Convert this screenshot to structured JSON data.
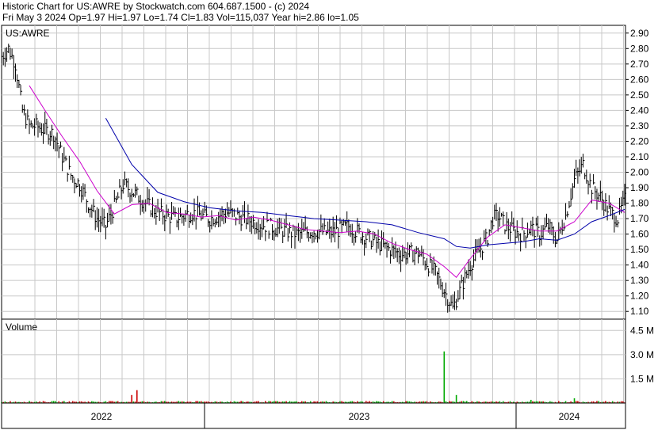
{
  "header": {
    "line1": "Historic Chart for US:AWRE by Stockwatch.com 604.687.1500 - (c) 2024",
    "line2": "Fri May  3 2024  Op=1.97  Hi=1.97  Lo=1.74  Cl=1.83  Vol=115,037  Year hi=2.86  lo=1.05"
  },
  "colors": {
    "price": "#000000",
    "ma_short": "#cc00cc",
    "ma_long": "#0000aa",
    "volume_up": "#00aa00",
    "volume_down": "#cc0000",
    "grid": "#c8c8c8"
  },
  "chart_data": [
    {
      "type": "line",
      "label": "US:AWRE",
      "ylim": [
        1.05,
        2.95
      ],
      "y_ticks": [
        "2.90",
        "2.80",
        "2.70",
        "2.60",
        "2.50",
        "2.40",
        "2.30",
        "2.20",
        "2.10",
        "2.00",
        "1.90",
        "1.80",
        "1.70",
        "1.60",
        "1.50",
        "1.40",
        "1.30",
        "1.20",
        "1.10"
      ],
      "x_labels": [
        "2022",
        "2023",
        "2024"
      ],
      "grid": true,
      "series": [
        {
          "key": "price",
          "x": [
            0,
            4,
            8,
            12,
            16,
            20,
            25,
            30,
            35,
            40,
            45,
            50,
            55,
            60,
            65,
            70,
            75,
            80,
            85,
            90,
            95,
            100,
            110,
            120,
            130,
            140,
            150,
            160,
            170,
            180,
            190,
            200,
            210,
            220,
            230,
            240,
            250,
            260,
            270,
            280,
            283,
            286,
            290,
            295,
            300,
            305,
            310,
            315,
            320,
            325,
            330,
            335,
            340,
            345,
            350,
            355,
            359
          ],
          "y": [
            2.75,
            2.8,
            2.7,
            2.4,
            2.3,
            2.3,
            2.27,
            2.25,
            2.1,
            1.98,
            1.92,
            1.8,
            1.7,
            1.65,
            1.78,
            1.92,
            1.88,
            1.83,
            1.78,
            1.74,
            1.72,
            1.7,
            1.74,
            1.7,
            1.74,
            1.7,
            1.66,
            1.63,
            1.6,
            1.62,
            1.61,
            1.65,
            1.58,
            1.52,
            1.47,
            1.48,
            1.35,
            1.12,
            1.4,
            1.58,
            1.7,
            1.72,
            1.66,
            1.62,
            1.6,
            1.64,
            1.6,
            1.65,
            1.56,
            1.72,
            1.95,
            2.05,
            1.9,
            1.84,
            1.75,
            1.7,
            1.82
          ]
        },
        {
          "key": "ma_short",
          "x": [
            16,
            25,
            35,
            45,
            55,
            65,
            75,
            85,
            95,
            105,
            115,
            125,
            135,
            145,
            155,
            165,
            175,
            185,
            195,
            205,
            215,
            225,
            235,
            245,
            255,
            262,
            270,
            280,
            290,
            300,
            310,
            320,
            330,
            340,
            350,
            359
          ],
          "y": [
            2.56,
            2.4,
            2.23,
            2.07,
            1.88,
            1.73,
            1.79,
            1.8,
            1.74,
            1.73,
            1.71,
            1.72,
            1.69,
            1.71,
            1.69,
            1.66,
            1.63,
            1.62,
            1.61,
            1.62,
            1.6,
            1.54,
            1.5,
            1.47,
            1.39,
            1.32,
            1.44,
            1.58,
            1.66,
            1.64,
            1.62,
            1.62,
            1.68,
            1.82,
            1.8,
            1.74
          ]
        },
        {
          "key": "ma_long",
          "x": [
            60,
            75,
            90,
            105,
            120,
            135,
            150,
            165,
            180,
            195,
            210,
            225,
            240,
            255,
            262,
            270,
            280,
            290,
            300,
            310,
            320,
            330,
            340,
            350,
            359
          ],
          "y": [
            2.35,
            2.05,
            1.87,
            1.81,
            1.77,
            1.75,
            1.74,
            1.72,
            1.7,
            1.69,
            1.68,
            1.66,
            1.61,
            1.57,
            1.52,
            1.51,
            1.53,
            1.54,
            1.55,
            1.57,
            1.56,
            1.6,
            1.68,
            1.72,
            1.76
          ]
        }
      ]
    },
    {
      "type": "bar",
      "label": "Volume",
      "ylim": [
        0,
        5.2
      ],
      "y_ticks": [
        "4.5 M",
        "3.0 M",
        "1.5 M"
      ],
      "series": [
        {
          "key": "volume_spikes",
          "x": [
            75,
            78,
            255,
            262,
            305,
            330
          ],
          "values": [
            0.5,
            0.8,
            3.2,
            0.5,
            0.2,
            0.3
          ]
        }
      ]
    }
  ]
}
